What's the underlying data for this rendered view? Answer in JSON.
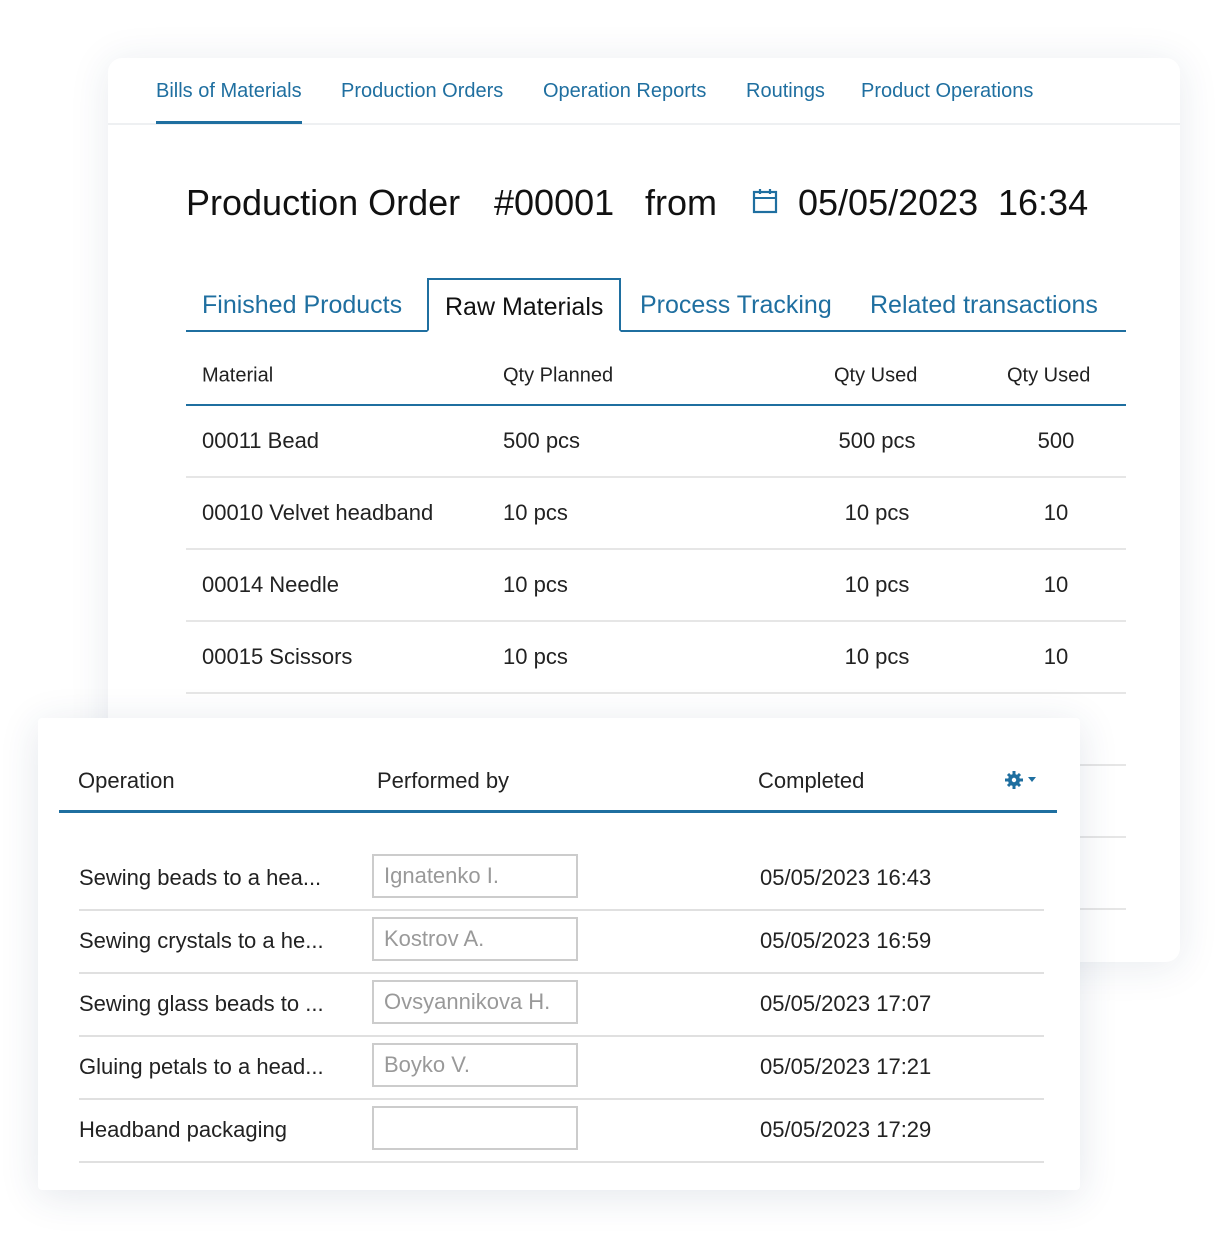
{
  "nav": {
    "items": [
      "Bills of Materials",
      "Production Orders",
      "Operation Reports",
      "Routings",
      "Product Operations"
    ],
    "active": 0
  },
  "header": {
    "label": "Production Order",
    "number": "#00001",
    "from": "from",
    "date": "05/05/2023",
    "time": "16:34"
  },
  "subtabs": {
    "items": [
      "Finished Products",
      "Raw Materials",
      "Process Tracking",
      "Related transactions"
    ],
    "active": 1
  },
  "materials": {
    "columns": [
      "Material",
      "Qty Planned",
      "Qty Used",
      "Qty Used"
    ],
    "rows": [
      [
        "00011 Bead",
        "500 pcs",
        "500 pcs",
        "500"
      ],
      [
        "00010 Velvet headband",
        "10 pcs",
        "10 pcs",
        "10"
      ],
      [
        "00014 Needle",
        "10 pcs",
        "10 pcs",
        "10"
      ],
      [
        "00015 Scissors",
        "10 pcs",
        "10 pcs",
        "10"
      ]
    ]
  },
  "operations": {
    "columns": [
      "Operation",
      "Performed by",
      "Completed"
    ],
    "settings_icon": "gear-dropdown-icon",
    "rows": [
      {
        "operation": "Sewing beads to a hea...",
        "performer": "Ignatenko I.",
        "completed": "05/05/2023 16:43"
      },
      {
        "operation": "Sewing crystals to a he...",
        "performer": "Kostrov A.",
        "completed": "05/05/2023 16:59"
      },
      {
        "operation": "Sewing glass beads to ...",
        "performer": "Ovsyannikova H.",
        "completed": "05/05/2023 17:07"
      },
      {
        "operation": "Gluing petals to a head...",
        "performer": "Boyko V.",
        "completed": "05/05/2023 17:21"
      },
      {
        "operation": "Headband packaging",
        "performer": "",
        "completed": "05/05/2023 17:29"
      }
    ]
  },
  "colors": {
    "accent": "#1f6fa0"
  }
}
